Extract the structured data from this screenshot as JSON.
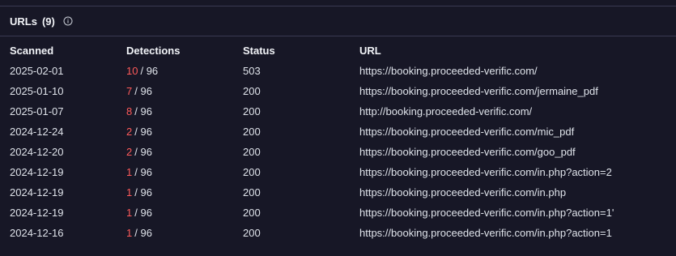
{
  "panel": {
    "title": "URLs",
    "count": "(9)",
    "info_icon": "info-circle-icon"
  },
  "columns": [
    "Scanned",
    "Detections",
    "Status",
    "URL"
  ],
  "rows": [
    {
      "scanned": "2025-02-01",
      "hits": "10",
      "total": "/ 96",
      "status": "503",
      "url": "https://booking.proceeded-verific.com/"
    },
    {
      "scanned": "2025-01-10",
      "hits": "7",
      "total": "/ 96",
      "status": "200",
      "url": "https://booking.proceeded-verific.com/jermaine_pdf"
    },
    {
      "scanned": "2025-01-07",
      "hits": "8",
      "total": "/ 96",
      "status": "200",
      "url": "http://booking.proceeded-verific.com/"
    },
    {
      "scanned": "2024-12-24",
      "hits": "2",
      "total": "/ 96",
      "status": "200",
      "url": "https://booking.proceeded-verific.com/mic_pdf"
    },
    {
      "scanned": "2024-12-20",
      "hits": "2",
      "total": "/ 96",
      "status": "200",
      "url": "https://booking.proceeded-verific.com/goo_pdf"
    },
    {
      "scanned": "2024-12-19",
      "hits": "1",
      "total": "/ 96",
      "status": "200",
      "url": "https://booking.proceeded-verific.com/in.php?action=2"
    },
    {
      "scanned": "2024-12-19",
      "hits": "1",
      "total": "/ 96",
      "status": "200",
      "url": "https://booking.proceeded-verific.com/in.php"
    },
    {
      "scanned": "2024-12-19",
      "hits": "1",
      "total": "/ 96",
      "status": "200",
      "url": "https://booking.proceeded-verific.com/in.php?action=1'"
    },
    {
      "scanned": "2024-12-16",
      "hits": "1",
      "total": "/ 96",
      "status": "200",
      "url": "https://booking.proceeded-verific.com/in.php?action=1"
    }
  ],
  "colors": {
    "background": "#171726",
    "detection_hit": "#ff5a5a",
    "divider": "#3a3a52"
  }
}
